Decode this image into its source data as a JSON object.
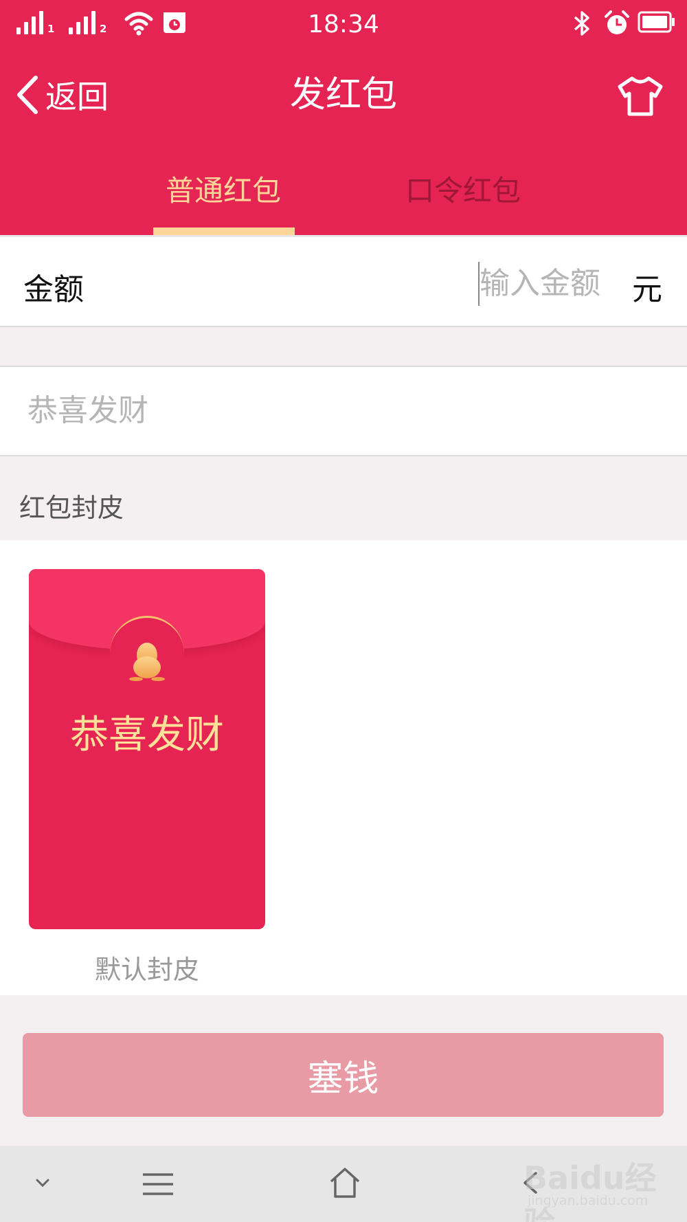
{
  "status_bar": {
    "time": "18:34",
    "sim1": "1",
    "sim2": "2"
  },
  "nav": {
    "back_label": "返回",
    "title": "发红包"
  },
  "tabs": [
    {
      "label": "普通红包",
      "active": true
    },
    {
      "label": "口令红包",
      "active": false
    }
  ],
  "amount": {
    "label": "金额",
    "placeholder": "输入金额",
    "unit": "元"
  },
  "greeting": {
    "placeholder": "恭喜发财"
  },
  "cover_section": {
    "title": "红包封皮",
    "cover_text": "恭喜发财",
    "cover_name": "默认封皮"
  },
  "submit": {
    "label": "塞钱"
  },
  "watermark": {
    "logo": "Baidu经验",
    "sub": "jingyan.baidu.com"
  },
  "colors": {
    "primary": "#e62453",
    "tab_active": "#ffd59a",
    "button": "#e89aa5"
  }
}
